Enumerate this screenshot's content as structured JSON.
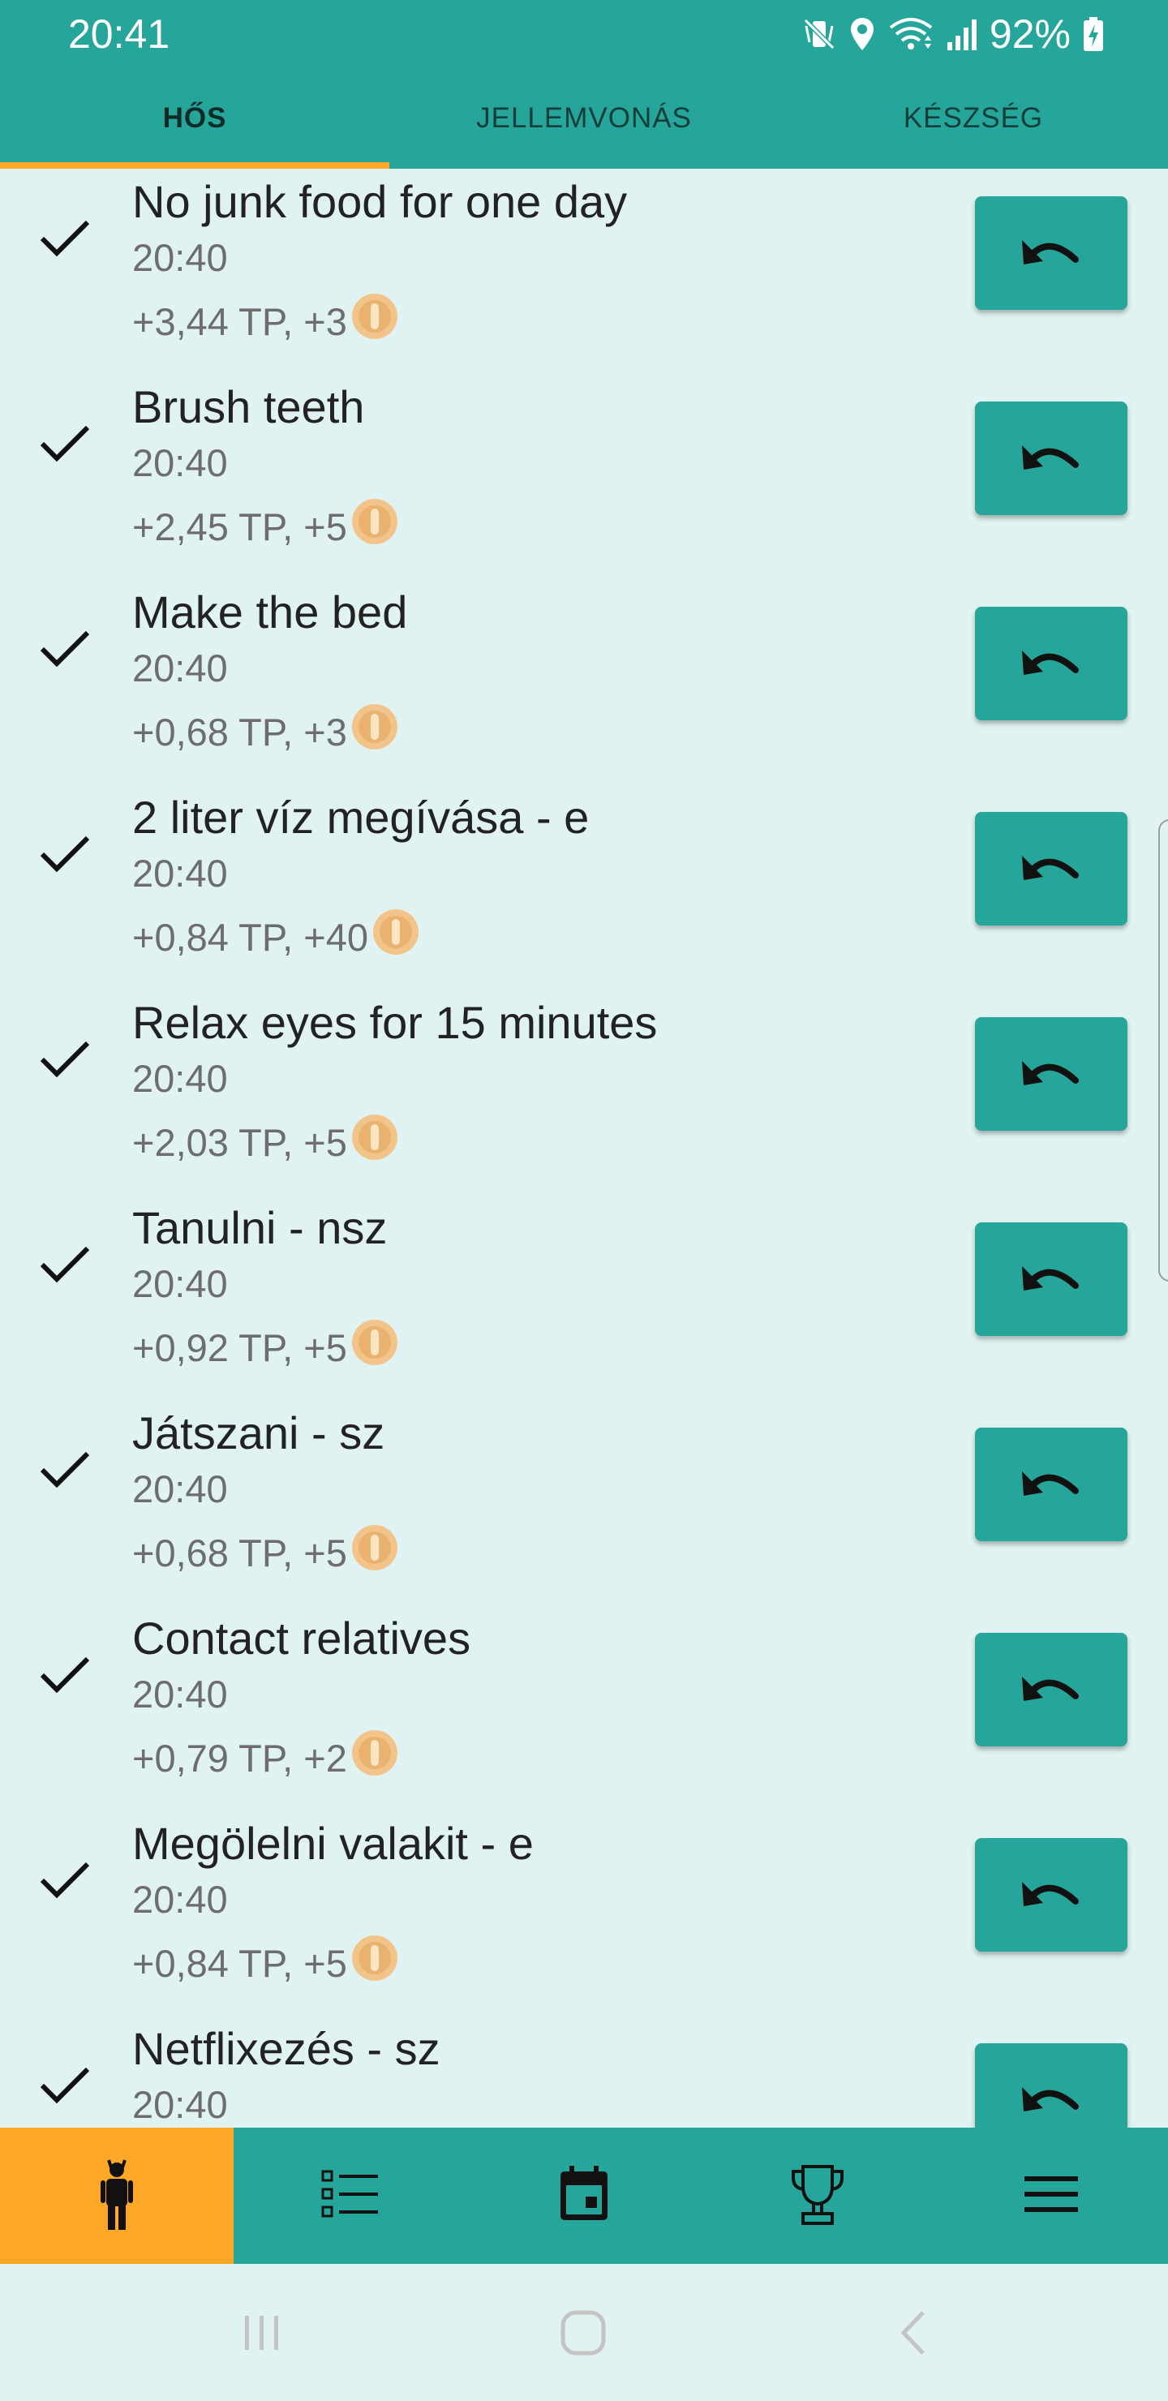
{
  "status_bar": {
    "time": "20:41",
    "battery_percent": "92%",
    "icons": [
      "mute-vibrate-icon",
      "location-icon",
      "wifi-icon",
      "signal-icon",
      "battery-charging-icon"
    ]
  },
  "tabs": [
    {
      "label": "HŐS",
      "active": true
    },
    {
      "label": "JELLEMVONÁS",
      "active": false
    },
    {
      "label": "KÉSZSÉG",
      "active": false
    }
  ],
  "tasks": [
    {
      "title": "No junk food for one day",
      "time": "20:40",
      "reward": "+3,44 TP, +3"
    },
    {
      "title": "Brush teeth",
      "time": "20:40",
      "reward": "+2,45 TP, +5"
    },
    {
      "title": "Make the bed",
      "time": "20:40",
      "reward": "+0,68 TP, +3"
    },
    {
      "title": "2 liter víz megívása - e",
      "time": "20:40",
      "reward": "+0,84 TP, +40"
    },
    {
      "title": "Relax eyes for 15 minutes",
      "time": "20:40",
      "reward": "+2,03 TP, +5"
    },
    {
      "title": "Tanulni - nsz",
      "time": "20:40",
      "reward": "+0,92 TP, +5"
    },
    {
      "title": "Játszani - sz",
      "time": "20:40",
      "reward": "+0,68 TP, +5"
    },
    {
      "title": "Contact relatives",
      "time": "20:40",
      "reward": "+0,79 TP, +2"
    },
    {
      "title": "Megölelni valakit - e",
      "time": "20:40",
      "reward": "+0,84 TP, +5"
    },
    {
      "title": "Netflixezés - sz",
      "time": "20:40",
      "reward": ""
    }
  ],
  "bottom_nav": [
    {
      "icon": "hero-person-icon",
      "active": true
    },
    {
      "icon": "task-list-icon",
      "active": false
    },
    {
      "icon": "calendar-icon",
      "active": false
    },
    {
      "icon": "trophy-icon",
      "active": false
    },
    {
      "icon": "menu-icon",
      "active": false
    }
  ],
  "system_nav": [
    "recents-icon",
    "home-icon",
    "back-icon"
  ],
  "colors": {
    "primary": "#26a69a",
    "accent": "#ffa726",
    "background": "#e0f2f1",
    "coin": "#f2c48a"
  }
}
